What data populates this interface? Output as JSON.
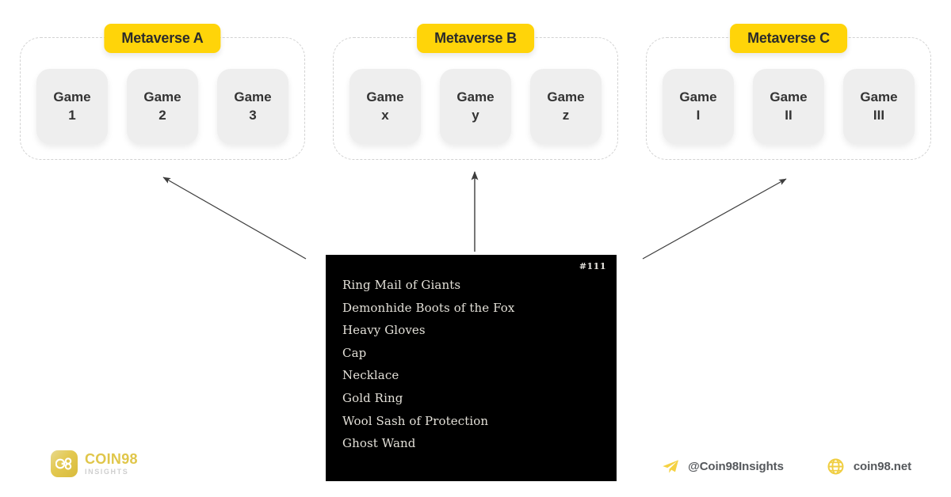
{
  "theme": {
    "accent_yellow": "#FFD409",
    "card_gray": "#EEEEEE",
    "panel_black": "#000000",
    "brand_gold": "#E0C64A",
    "footer_text": "#55585C"
  },
  "groups": [
    {
      "label": "Metaverse A",
      "games": [
        {
          "line1": "Game",
          "line2": "1"
        },
        {
          "line1": "Game",
          "line2": "2"
        },
        {
          "line1": "Game",
          "line2": "3"
        }
      ]
    },
    {
      "label": "Metaverse B",
      "games": [
        {
          "line1": "Game",
          "line2": "x"
        },
        {
          "line1": "Game",
          "line2": "y"
        },
        {
          "line1": "Game",
          "line2": "z"
        }
      ]
    },
    {
      "label": "Metaverse C",
      "games": [
        {
          "line1": "Game",
          "line2": "I"
        },
        {
          "line1": "Game",
          "line2": "II"
        },
        {
          "line1": "Game",
          "line2": "III"
        }
      ]
    }
  ],
  "panel": {
    "id_label": "#111",
    "items": [
      "Ring Mail of Giants",
      "Demonhide Boots of the Fox",
      "Heavy Gloves",
      "Cap",
      "Necklace",
      "Gold Ring",
      "Wool Sash of Protection",
      "Ghost Wand"
    ]
  },
  "arrows": [
    {
      "name": "arrow-to-metaverse-a",
      "direction": "up-left"
    },
    {
      "name": "arrow-to-metaverse-b",
      "direction": "up"
    },
    {
      "name": "arrow-to-metaverse-c",
      "direction": "up-right"
    }
  ],
  "brand": {
    "badge_text": "98",
    "name": "COIN98",
    "subtitle": "INSIGHTS"
  },
  "social": [
    {
      "icon": "telegram-icon",
      "label": "@Coin98Insights"
    },
    {
      "icon": "globe-icon",
      "label": "coin98.net"
    }
  ]
}
